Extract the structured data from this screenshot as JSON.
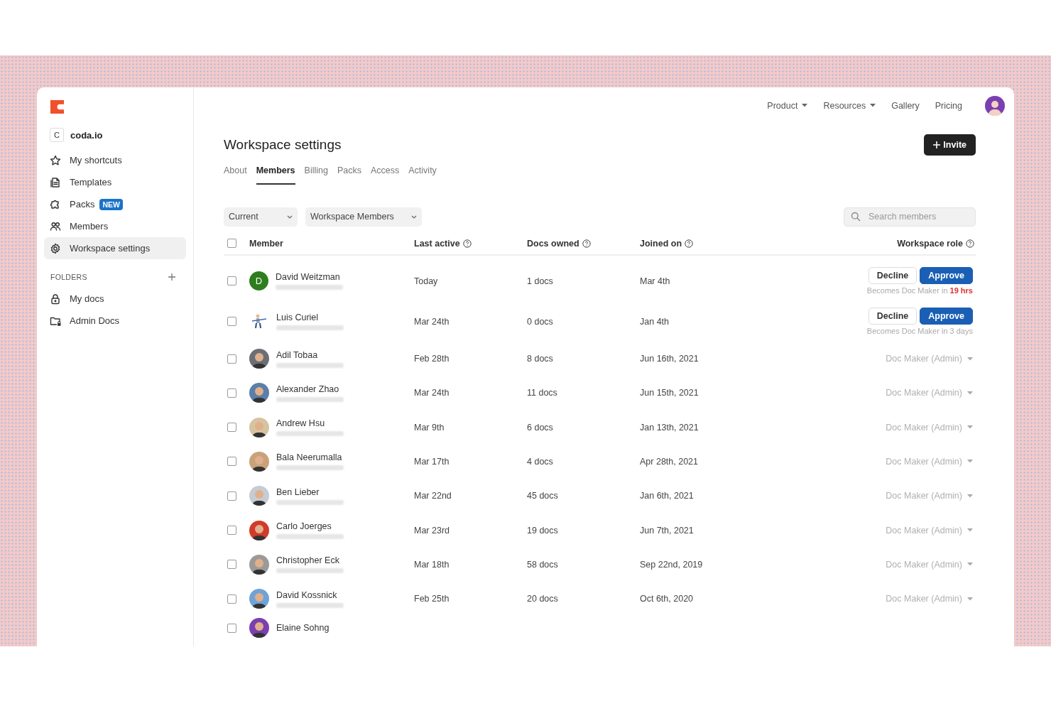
{
  "sidebar": {
    "workspace": {
      "initial": "C",
      "name": "coda.io"
    },
    "items": [
      {
        "label": "My shortcuts",
        "selected": false
      },
      {
        "label": "Templates",
        "selected": false
      },
      {
        "label": "Packs",
        "badge": "NEW",
        "selected": false
      },
      {
        "label": "Members",
        "selected": false
      },
      {
        "label": "Workspace settings",
        "selected": true
      }
    ],
    "folders_heading": "FOLDERS",
    "folders": [
      {
        "label": "My docs"
      },
      {
        "label": "Admin Docs"
      }
    ]
  },
  "top_nav": [
    {
      "label": "Product",
      "dropdown": true
    },
    {
      "label": "Resources",
      "dropdown": true
    },
    {
      "label": "Gallery",
      "dropdown": false
    },
    {
      "label": "Pricing",
      "dropdown": false
    }
  ],
  "page_title": "Workspace settings",
  "invite_button": "Invite",
  "tabs": [
    {
      "label": "About",
      "selected": false
    },
    {
      "label": "Members",
      "selected": true
    },
    {
      "label": "Billing",
      "selected": false
    },
    {
      "label": "Packs",
      "selected": false
    },
    {
      "label": "Access",
      "selected": false
    },
    {
      "label": "Activity",
      "selected": false
    }
  ],
  "filters": [
    "Current",
    "Workspace Members"
  ],
  "search": {
    "placeholder": "Search members"
  },
  "table": {
    "header_checked": false,
    "columns": [
      {
        "label": "Member",
        "help": false
      },
      {
        "label": "Last active",
        "help": true
      },
      {
        "label": "Docs owned",
        "help": true
      },
      {
        "label": "Joined on",
        "help": true
      },
      {
        "label": "Workspace role",
        "help": true
      }
    ],
    "rows": [
      {
        "checked": false,
        "avatar": {
          "kind": "letter",
          "letter": "D",
          "color": "#2e7d1f"
        },
        "name": "David Weitzman",
        "last_active": "Today",
        "docs": "1 docs",
        "joined": "Mar 4th",
        "role": {
          "kind": "pending",
          "decline": "Decline",
          "approve": "Approve",
          "note": "Becomes Doc Maker in",
          "due": "19 hrs",
          "urgent": true
        }
      },
      {
        "checked": false,
        "avatar": {
          "kind": "figure"
        },
        "name": "Luis Curiel",
        "last_active": "Mar 24th",
        "docs": "0 docs",
        "joined": "Jan 4th",
        "role": {
          "kind": "pending",
          "decline": "Decline",
          "approve": "Approve",
          "note": "Becomes Doc Maker in",
          "due": "3 days",
          "urgent": false
        }
      },
      {
        "checked": false,
        "avatar": {
          "kind": "photo",
          "color": "#6b6f75"
        },
        "name": "Adil Tobaa",
        "last_active": "Feb 28th",
        "docs": "8 docs",
        "joined": "Jun 16th, 2021",
        "role": {
          "kind": "dropdown",
          "label": "Doc Maker (Admin)"
        }
      },
      {
        "checked": false,
        "avatar": {
          "kind": "photo",
          "color": "#5a7fa8"
        },
        "name": "Alexander Zhao",
        "last_active": "Mar 24th",
        "docs": "11 docs",
        "joined": "Jun 15th, 2021",
        "role": {
          "kind": "dropdown",
          "label": "Doc Maker (Admin)"
        }
      },
      {
        "checked": false,
        "avatar": {
          "kind": "photo",
          "color": "#d8c3a0"
        },
        "name": "Andrew Hsu",
        "last_active": "Mar 9th",
        "docs": "6 docs",
        "joined": "Jan 13th, 2021",
        "role": {
          "kind": "dropdown",
          "label": "Doc Maker (Admin)"
        }
      },
      {
        "checked": false,
        "avatar": {
          "kind": "photo",
          "color": "#c9a27a"
        },
        "name": "Bala Neerumalla",
        "last_active": "Mar 17th",
        "docs": "4 docs",
        "joined": "Apr 28th, 2021",
        "role": {
          "kind": "dropdown",
          "label": "Doc Maker (Admin)"
        }
      },
      {
        "checked": false,
        "avatar": {
          "kind": "photo",
          "color": "#c6ccd4"
        },
        "name": "Ben Lieber",
        "last_active": "Mar 22nd",
        "docs": "45 docs",
        "joined": "Jan 6th, 2021",
        "role": {
          "kind": "dropdown",
          "label": "Doc Maker (Admin)"
        }
      },
      {
        "checked": false,
        "avatar": {
          "kind": "photo",
          "color": "#d23a2a"
        },
        "name": "Carlo Joerges",
        "last_active": "Mar 23rd",
        "docs": "19 docs",
        "joined": "Jun 7th, 2021",
        "role": {
          "kind": "dropdown",
          "label": "Doc Maker (Admin)"
        }
      },
      {
        "checked": false,
        "avatar": {
          "kind": "photo",
          "color": "#9a9a9a"
        },
        "name": "Christopher Eck",
        "last_active": "Mar 18th",
        "docs": "58 docs",
        "joined": "Sep 22nd, 2019",
        "role": {
          "kind": "dropdown",
          "label": "Doc Maker (Admin)"
        }
      },
      {
        "checked": false,
        "avatar": {
          "kind": "photo",
          "color": "#6fa3d8"
        },
        "name": "David Kossnick",
        "last_active": "Feb 25th",
        "docs": "20 docs",
        "joined": "Oct 6th, 2020",
        "role": {
          "kind": "dropdown",
          "label": "Doc Maker (Admin)"
        }
      },
      {
        "checked": false,
        "avatar": {
          "kind": "photo",
          "color": "#7b3fb0"
        },
        "name": "Elaine Sohng",
        "role": {
          "kind": "none"
        }
      }
    ]
  }
}
